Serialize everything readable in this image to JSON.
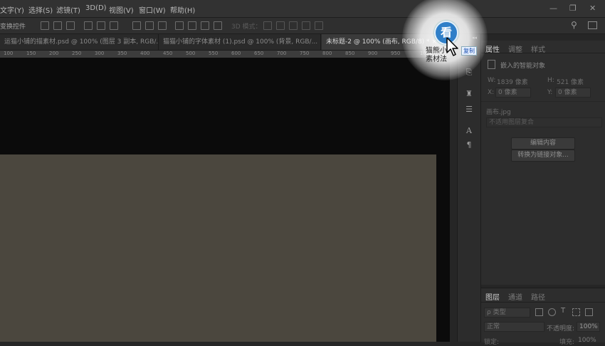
{
  "menu": [
    "文字(Y)",
    "选择(S)",
    "滤镜(T)",
    "3D(D)",
    "视图(V)",
    "窗口(W)",
    "帮助(H)"
  ],
  "window_controls": {
    "minimize": "—",
    "restore": "❐",
    "close": "✕"
  },
  "options_bar": {
    "label": "变换控件",
    "mode_label": "3D 模式："
  },
  "tabs": [
    {
      "label": "运猫小铺的描素材.psd @ 100% (图层 3 副本, RGB/..."
    },
    {
      "label": "猫猫小铺的字体素材 (1).psd @ 100% (背景, RGB/..."
    },
    {
      "label": "未标题-2 @ 100% (画布, RGB/8) *"
    }
  ],
  "tab_close": "×",
  "ruler_labels": [
    "100",
    "150",
    "200",
    "250",
    "300",
    "350",
    "400",
    "450",
    "500",
    "550",
    "600",
    "650",
    "700",
    "750",
    "800",
    "850",
    "900",
    "950",
    "1000"
  ],
  "overlay": {
    "badge": "看",
    "text": "猫熊小\n素材法",
    "copy": "复制"
  },
  "properties": {
    "tabs": [
      "属性",
      "调整",
      "样式"
    ],
    "title": "嵌入的智能对象",
    "w_label": "W:",
    "w_value": "1839 像素",
    "h_label": "H:",
    "h_value": "521 像素",
    "x_label": "X:",
    "x_value": "0 像素",
    "y_label": "Y:",
    "y_value": "0 像素",
    "filename": "画布.jpg",
    "comp_placeholder": "不适用图层复合",
    "edit_button": "编辑内容",
    "convert_button": "转换为链接对象..."
  },
  "layers": {
    "tabs": [
      "图层",
      "通道",
      "路径"
    ],
    "filter_label": "ρ 类型",
    "blend_mode": "正常",
    "opacity_label": "不透明度:",
    "opacity_value": "100%",
    "lock_label": "锁定:",
    "fill_label": "填充:",
    "fill_value": "100%"
  }
}
